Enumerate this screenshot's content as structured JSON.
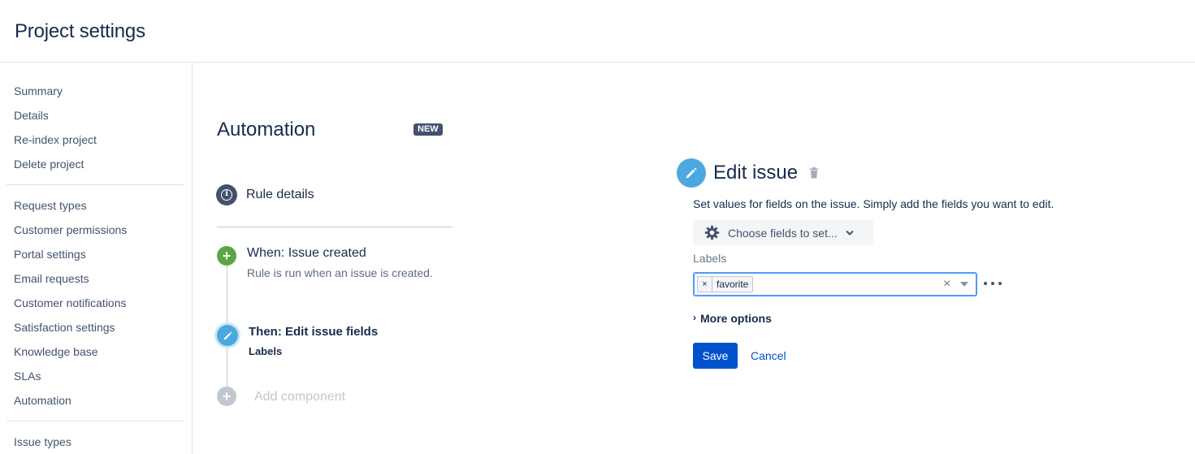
{
  "header": {
    "title": "Project settings"
  },
  "sidebar": {
    "group1": [
      "Summary",
      "Details",
      "Re-index project",
      "Delete project"
    ],
    "group2": [
      "Request types",
      "Customer permissions",
      "Portal settings",
      "Email requests",
      "Customer notifications",
      "Satisfaction settings",
      "Knowledge base",
      "SLAs",
      "Automation"
    ],
    "group3": [
      "Issue types"
    ]
  },
  "automation": {
    "title": "Automation",
    "badge": "NEW",
    "rule_details": "Rule details",
    "when": {
      "title": "When: Issue created",
      "subtitle": "Rule is run when an issue is created."
    },
    "then": {
      "title": "Then: Edit issue fields",
      "subtitle": "Labels"
    },
    "add_component": "Add component"
  },
  "edit_panel": {
    "title": "Edit issue",
    "description": "Set values for fields on the issue. Simply add the fields you want to edit.",
    "choose_fields": "Choose fields to set...",
    "labels_label": "Labels",
    "labels_tags": [
      "favorite"
    ],
    "tag_remove": "×",
    "clear": "×",
    "more_options": "More options",
    "save": "Save",
    "cancel": "Cancel"
  },
  "colors": {
    "primary": "#0052cc",
    "green_step": "#5aa645",
    "blue_step": "#4ca9e0",
    "focus_border": "#4c9aff"
  }
}
